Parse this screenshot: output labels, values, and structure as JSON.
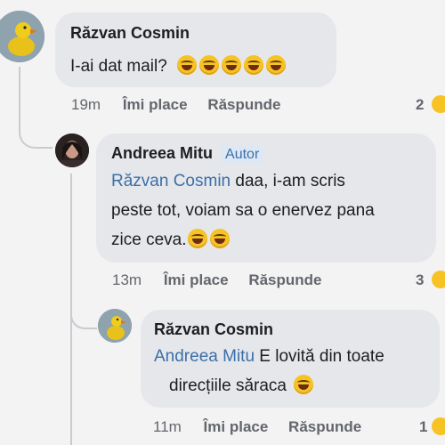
{
  "comments": [
    {
      "author": "Răzvan Cosmin",
      "text": "I-ai dat mail?",
      "emoji": [
        "laughing-emoji",
        "laughing-emoji",
        "laughing-emoji",
        "laughing-emoji",
        "laughing-emoji"
      ],
      "time": "19m",
      "like_label": "Îmi place",
      "reply_label": "Răspunde",
      "reaction_count": "2"
    },
    {
      "author": "Andreea Mitu",
      "badge": "Autor",
      "mention": "Răzvan Cosmin",
      "text_line1": " daa, i-am scris",
      "text_line2": "peste tot, voiam sa o enervez pana",
      "text_line3": "zice ceva.",
      "time": "13m",
      "like_label": "Îmi place",
      "reply_label": "Răspunde",
      "reaction_count": "3"
    },
    {
      "author": "Răzvan Cosmin",
      "mention": "Andreea Mitu",
      "text_line1": " E lovită din toate",
      "text_line2": "direcțiile săraca",
      "time": "11m",
      "like_label": "Îmi place",
      "reply_label": "Răspunde",
      "reaction_count": "1"
    }
  ],
  "colors": {
    "background": "#f3f3f4",
    "bubble": "#e6e7ea",
    "mention": "#3b6fa8",
    "meta_text": "#63666b"
  }
}
